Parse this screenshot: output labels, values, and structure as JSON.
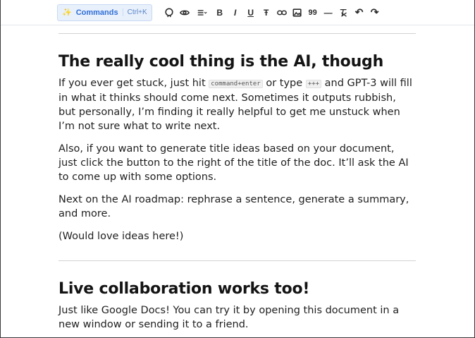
{
  "toolbar": {
    "commands_label": "Commands",
    "commands_shortcut": "Ctrl+K",
    "bold_glyph": "B",
    "italic_glyph": "I",
    "underline_glyph": "U",
    "strike_glyph": "Ŧ",
    "quote_glyph": "99",
    "hr_glyph": "—",
    "undo_glyph": "↶",
    "redo_glyph": "↷"
  },
  "sections": [
    {
      "heading": "The really cool thing is the AI, though",
      "p1_before": "If you ever get stuck, just hit ",
      "p1_code1": "command+enter",
      "p1_mid": " or type ",
      "p1_code2": "+++",
      "p1_after": " and GPT-3 will fill in what it thinks should come next. Sometimes it outputs rubbish, but personally, I’m finding it really helpful to get me unstuck when I’m not sure what to write next.",
      "p2": "Also, if you want to generate title ideas based on your document, just click the button to the right of the title of the doc. It’ll ask the AI to come up with some options.",
      "p3": "Next on the AI roadmap: rephrase a sentence, generate a summary, and more.",
      "p4": "(Would love ideas here!)"
    },
    {
      "heading": "Live collaboration works too!",
      "p1": "Just like Google Docs! You can try it by opening this document in a new window or sending it to a friend."
    }
  ],
  "icons": [
    "magic-wand-icon",
    "github-icon",
    "eye-icon",
    "list-icon",
    "link-icon",
    "image-icon",
    "clear-format-icon",
    "undo-icon",
    "redo-icon"
  ],
  "colors": {
    "accent": "#2f6fd6",
    "accent_bg": "#e8f0fb",
    "text": "#1f1f1f",
    "rule": "#d3d3d3"
  }
}
